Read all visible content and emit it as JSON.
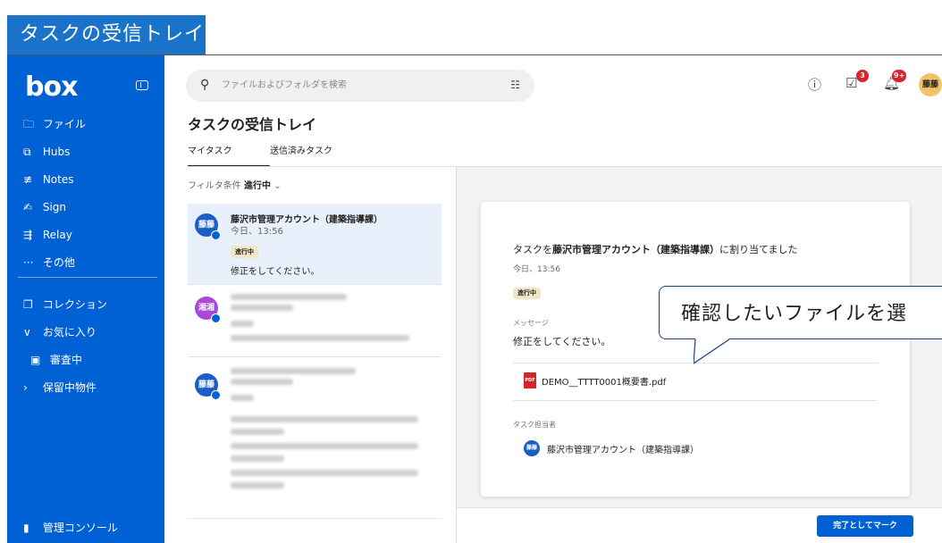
{
  "page_title": "タスクの受信トレイ",
  "sidebar": {
    "logo": "box",
    "items": [
      {
        "icon": "folder-icon",
        "glyph": "🗀",
        "label": "ファイル"
      },
      {
        "icon": "hubs-icon",
        "glyph": "⧉",
        "label": "Hubs"
      },
      {
        "icon": "notes-icon",
        "glyph": "≢",
        "label": "Notes"
      },
      {
        "icon": "sign-icon",
        "glyph": "✍",
        "label": "Sign"
      },
      {
        "icon": "relay-icon",
        "glyph": "⇶",
        "label": "Relay"
      },
      {
        "icon": "more-icon",
        "glyph": "···",
        "label": "その他"
      }
    ],
    "collections": [
      {
        "icon": "collection-icon",
        "glyph": "❐",
        "label": "コレクション"
      },
      {
        "icon": "chevron-down-icon",
        "glyph": "∨",
        "label": "お気に入り"
      },
      {
        "icon": "folder-shared-icon",
        "glyph": "▣",
        "label": "審査中"
      },
      {
        "icon": "chevron-right-icon",
        "glyph": "›",
        "label": "保留中物件"
      }
    ],
    "admin": {
      "icon": "chart-icon",
      "glyph": "▮",
      "label": "管理コンソール"
    }
  },
  "header": {
    "search_placeholder": "ファイルおよびフォルダを検索",
    "tasks_badge": "3",
    "notifications_badge": "9+",
    "user_initials": "藤藤"
  },
  "main": {
    "heading": "タスクの受信トレイ",
    "tabs": [
      "マイタスク",
      "送信済みタスク"
    ],
    "filter_label": "フィルタ条件",
    "filter_value": "進行中",
    "filter_caret": "⌄"
  },
  "tasks": [
    {
      "initials": "藤藤",
      "title": "藤沢市管理アカウント（建築指導課）",
      "time": "今日、13:56",
      "status": "進行中",
      "message": "修正をしてください。"
    },
    {
      "initials": "湘湘"
    },
    {
      "initials": "藤藤"
    }
  ],
  "detail": {
    "line_pre": "タスクを",
    "line_bold": "藤沢市管理アカウント（建築指導課）",
    "line_post": "に割り当てました",
    "time": "今日、13:56",
    "status": "進行中",
    "message_label": "メッセージ",
    "message": "修正をしてください。",
    "file_icon": "PDF",
    "file_name": "DEMO__TTTT0001概要書.pdf",
    "assignee_label": "タスク担当者",
    "assignee_initials": "藤藤",
    "assignee_name": "藤沢市管理アカウント（建築指導課）",
    "complete_button": "完了としてマーク"
  },
  "callout": "確認したいファイルを選"
}
